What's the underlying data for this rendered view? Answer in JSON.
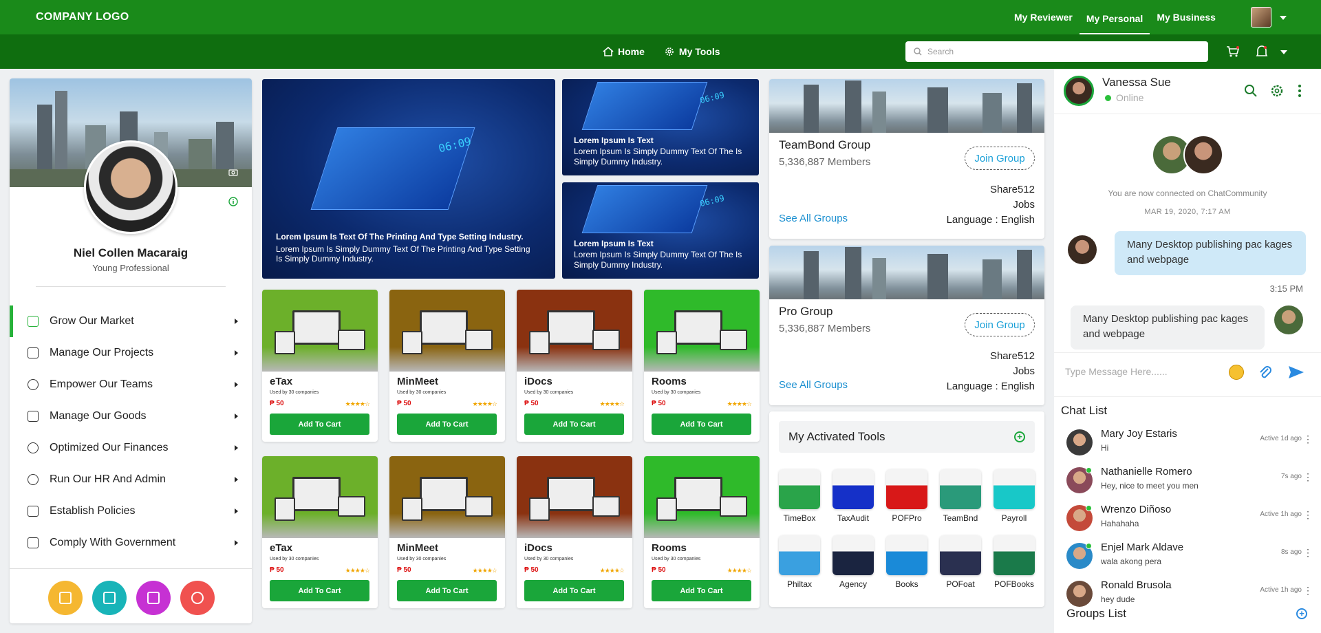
{
  "header": {
    "logo": "COMPANY LOGO",
    "nav": [
      "My Reviewer",
      "My Personal",
      "My Business"
    ],
    "active_nav": "My Personal"
  },
  "subnav": {
    "home": "Home",
    "tools": "My Tools"
  },
  "search": {
    "placeholder": "Search"
  },
  "profile": {
    "name": "Niel Collen Macaraig",
    "role": "Young Professional",
    "menu": [
      "Grow Our Market",
      "Manage Our Projects",
      "Empower Our Teams",
      "Manage Our Goods",
      "Optimized Our Finances",
      "Run Our HR And Admin",
      "Establish Policies",
      "Comply With Government"
    ],
    "quick_colors": [
      "#f5b731",
      "#18b4b8",
      "#c631d3",
      "#f0514f"
    ]
  },
  "banners": {
    "main_title": "Lorem Ipsum Is Text Of The Printing And Type Setting Industry.",
    "main_text": "Lorem Ipsum Is Simply Dummy Text Of The Printing And Type Setting Is Simply Dummy Industry.",
    "small_title": "Lorem Ipsum Is Text",
    "small_text": "Lorem Ipsum Is Simply Dummy Text Of The Is Simply Dummy Industry.",
    "clock": "06:09"
  },
  "products": [
    {
      "name": "eTax",
      "sub": "Used by 30 companies",
      "price": "₱ 50",
      "stars": "★★★★☆",
      "btn": "Add To Cart",
      "bg": "#6cb02a"
    },
    {
      "name": "MinMeet",
      "sub": "Used by 30 companies",
      "price": "₱ 50",
      "stars": "★★★★☆",
      "btn": "Add To Cart",
      "bg": "#8a6410"
    },
    {
      "name": "iDocs",
      "sub": "Used by 30 companies",
      "price": "₱ 50",
      "stars": "★★★★☆",
      "btn": "Add To Cart",
      "bg": "#8a3210"
    },
    {
      "name": "Rooms",
      "sub": "Used by 30 companies",
      "price": "₱ 50",
      "stars": "★★★★☆",
      "btn": "Add To Cart",
      "bg": "#2fba2a"
    }
  ],
  "groups": [
    {
      "name": "TeamBond Group",
      "members": "5,336,887 Members",
      "join": "Join Group",
      "info": [
        "Share512",
        "Jobs",
        "Language : English"
      ],
      "see_all": "See All Groups"
    },
    {
      "name": "Pro Group",
      "members": "5,336,887 Members",
      "join": "Join Group",
      "info": [
        "Share512",
        "Jobs",
        "Language : English"
      ],
      "see_all": "See All Groups"
    }
  ],
  "tools": {
    "title": "My Activated Tools",
    "items": [
      {
        "name": "TimeBox",
        "color": "#2aa44a"
      },
      {
        "name": "TaxAudit",
        "color": "#1530c8"
      },
      {
        "name": "POFPro",
        "color": "#d81818"
      },
      {
        "name": "TeamBnd",
        "color": "#2a9a7a"
      },
      {
        "name": "Payroll",
        "color": "#18c8c8"
      },
      {
        "name": "Philtax",
        "color": "#3aa0e0"
      },
      {
        "name": "Agency",
        "color": "#1a2440"
      },
      {
        "name": "Books",
        "color": "#1a8ad8"
      },
      {
        "name": "POFoat",
        "color": "#2a3050"
      },
      {
        "name": "POFBooks",
        "color": "#1a7a4a"
      }
    ]
  },
  "chat": {
    "user": "Vanessa Sue",
    "status": "Online",
    "connected": "You are now connected on ChatCommunity",
    "date": "MAR 19, 2020, 7:17 AM",
    "msg_out": "Many Desktop publishing pac kages and webpage",
    "time_out": "3:15 PM",
    "msg_in": "Many Desktop publishing pac kages and webpage",
    "input_placeholder": "Type Message Here......",
    "chat_list_title": "Chat List",
    "chat_list": [
      {
        "name": "Mary Joy Estaris",
        "msg": "Hi",
        "time": "Active 1d ago"
      },
      {
        "name": "Nathanielle Romero",
        "msg": "Hey, nice to meet you men",
        "time": "7s ago"
      },
      {
        "name": "Wrenzo Diñoso",
        "msg": "Hahahaha",
        "time": "Active 1h ago"
      },
      {
        "name": "Enjel Mark Aldave",
        "msg": "wala akong pera",
        "time": "8s ago"
      },
      {
        "name": "Ronald Brusola",
        "msg": "hey dude",
        "time": "Active 1h ago"
      }
    ],
    "groups_list_title": "Groups List"
  }
}
